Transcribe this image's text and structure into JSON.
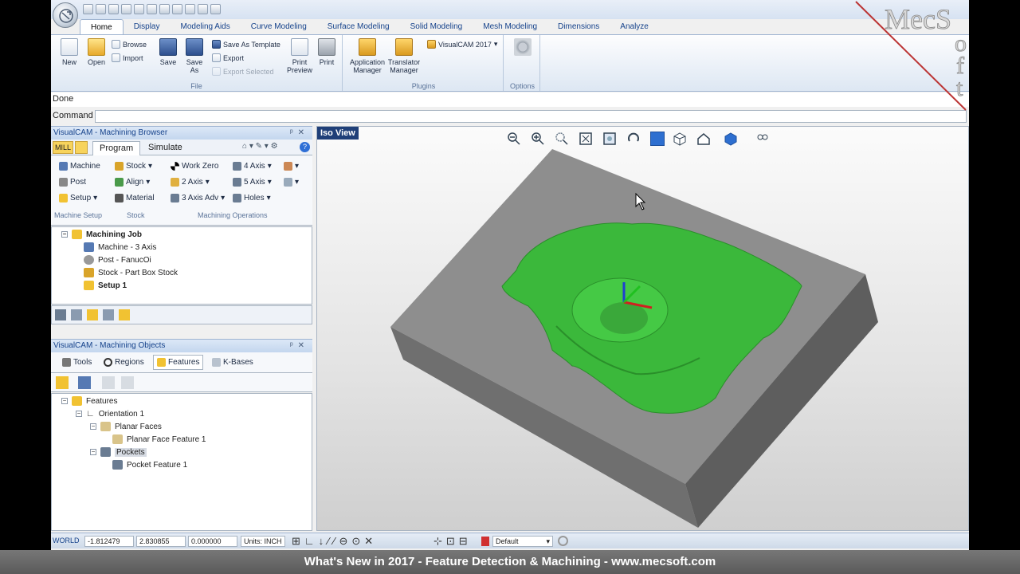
{
  "ribbon_tabs": [
    "Home",
    "Display",
    "Modeling Aids",
    "Curve Modeling",
    "Surface Modeling",
    "Solid Modeling",
    "Mesh Modeling",
    "Dimensions",
    "Analyze"
  ],
  "file_group": {
    "new": "New",
    "open": "Open",
    "browse": "Browse",
    "import": "Import",
    "save": "Save",
    "save_as": "Save As",
    "save_as_template": "Save As Template",
    "export": "Export",
    "export_selected": "Export Selected",
    "print_preview": "Print Preview",
    "print": "Print",
    "title": "File"
  },
  "plugins_group": {
    "app_manager": "Application Manager",
    "translator_manager": "Translator Manager",
    "visualcam": "VisualCAM 2017",
    "title": "Plugins"
  },
  "options_group": {
    "title": "Options"
  },
  "status_text": "Done",
  "command_label": "Command",
  "browser": {
    "title": "VisualCAM - Machining Browser",
    "mill": "MILL",
    "tabs": [
      "Program",
      "Simulate"
    ],
    "machine_setup": {
      "machine": "Machine",
      "post": "Post",
      "setup": "Setup",
      "title": "Machine Setup"
    },
    "stock": {
      "stock": "Stock",
      "align": "Align",
      "material": "Material",
      "title": "Stock"
    },
    "ops": {
      "work_zero": "Work Zero",
      "two_axis": "2 Axis",
      "three_axis_adv": "3 Axis Adv",
      "four_axis": "4 Axis",
      "five_axis": "5 Axis",
      "holes": "Holes",
      "title": "Machining Operations"
    },
    "tree": {
      "root": "Machining Job",
      "machine": "Machine - 3 Axis",
      "post": "Post - FanucOi",
      "stock": "Stock - Part Box Stock",
      "setup": "Setup 1"
    }
  },
  "objects": {
    "title": "VisualCAM - Machining Objects",
    "tabs": [
      "Tools",
      "Regions",
      "Features",
      "K-Bases"
    ],
    "tree": {
      "root": "Features",
      "orientation": "Orientation 1",
      "planar_faces": "Planar Faces",
      "planar_feature": "Planar Face Feature 1",
      "pockets": "Pockets",
      "pocket_feature": "Pocket Feature 1"
    }
  },
  "viewport": {
    "label": "Iso View"
  },
  "statusbar": {
    "world": "WORLD",
    "x": "-1.812479",
    "y": "2.830855",
    "z": "0.000000",
    "units": "Units: INCH",
    "layer": "Default"
  },
  "caption": "What's New in 2017 - Feature Detection & Machining - www.mecsoft.com",
  "logo_text": "MecSoft"
}
